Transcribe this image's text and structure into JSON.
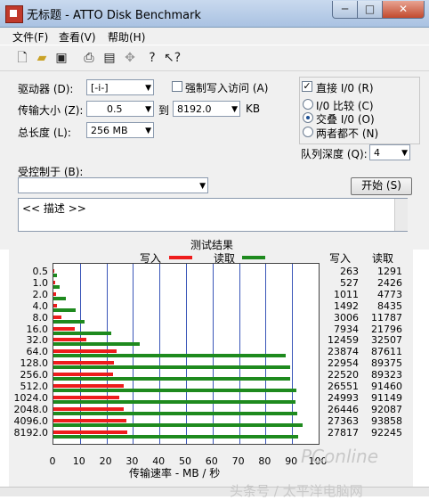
{
  "window": {
    "title": "无标题 - ATTO Disk Benchmark"
  },
  "menu": {
    "items": [
      "文件(F)",
      "查看(V)",
      "帮助(H)"
    ]
  },
  "form": {
    "drive_label": "驱动器 (D):",
    "drive_value": "[-i-]",
    "force_write_label": "强制写入访问 (A)",
    "transfer_label": "传输大小 (Z):",
    "transfer_from": "0.5",
    "to_label": "到",
    "transfer_to": "8192.0",
    "kb_label": "KB",
    "total_label": "总长度 (L):",
    "total_value": "256 MB",
    "direct_io_label": "直接 I/0 (R)",
    "io_compare_label": "I/0 比较 (C)",
    "overlap_io_label": "交叠 I/0 (O)",
    "neither_label": "两者都不 (N)",
    "queue_label": "队列深度 (Q):",
    "queue_value": "4",
    "controlled_label": "受控制于 (B):",
    "controlled_value": "",
    "start_label": "开始 (S)",
    "description": "<< 描述 >>"
  },
  "results": {
    "title": "测试结果",
    "legend_write": "写入",
    "legend_read": "读取",
    "col_write": "写入",
    "col_read": "读取",
    "xlabel": "传输速率 - MB / 秒",
    "write_color": "#ee1c1c",
    "read_color": "#1e8a1e"
  },
  "chart_data": {
    "type": "bar",
    "categories": [
      "0.5",
      "1.0",
      "2.0",
      "4.0",
      "8.0",
      "16.0",
      "32.0",
      "64.0",
      "128.0",
      "256.0",
      "512.0",
      "1024.0",
      "2048.0",
      "4096.0",
      "8192.0"
    ],
    "series": [
      {
        "name": "写入",
        "values": [
          263,
          527,
          1011,
          1492,
          3006,
          7934,
          12459,
          23874,
          22954,
          22520,
          26551,
          24993,
          26446,
          27363,
          27817
        ]
      },
      {
        "name": "读取",
        "values": [
          1291,
          2426,
          4773,
          8435,
          11787,
          21796,
          32507,
          87611,
          89375,
          89323,
          91460,
          91149,
          92087,
          93858,
          92245
        ]
      }
    ],
    "x_ticks": [
      "0",
      "10",
      "20",
      "30",
      "40",
      "50",
      "60",
      "70",
      "80",
      "90",
      "100"
    ],
    "xlim": [
      0,
      100
    ],
    "xlabel": "传输速率 - MB / 秒"
  },
  "watermark": "PConline",
  "watermark2": "头条号 / 太平洋电脑网"
}
